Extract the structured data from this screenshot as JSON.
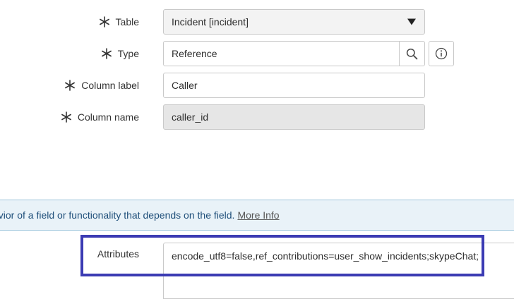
{
  "form": {
    "table": {
      "label": "Table",
      "value": "Incident [incident]"
    },
    "type": {
      "label": "Type",
      "value": "Reference"
    },
    "column_label": {
      "label": "Column label",
      "value": "Caller"
    },
    "column_name": {
      "label": "Column name",
      "value": "caller_id"
    }
  },
  "info_banner": {
    "message": "avior of a field or functionality that depends on the field.",
    "link": "More Info"
  },
  "attributes": {
    "label": "Attributes",
    "value": "encode_utf8=false,ref_contributions=user_show_incidents;skypeChat;"
  },
  "icons": {
    "mandatory": "asterisk-icon",
    "search": "magnifier-icon",
    "info": "info-icon",
    "dropdown": "caret-down-icon"
  },
  "colors": {
    "highlight_border": "#3b3bb3",
    "banner_bg": "#e9f2f8",
    "banner_text": "#1f4f7a",
    "readonly_bg": "#e6e6e6"
  }
}
